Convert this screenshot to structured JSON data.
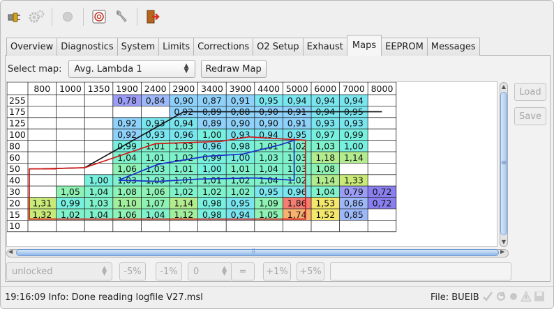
{
  "toolbar": {
    "items": [
      {
        "name": "connect-icon"
      },
      {
        "name": "settings-gears-icon"
      },
      {
        "name": "record-icon"
      },
      {
        "name": "target-icon"
      },
      {
        "name": "wrench-tools-icon"
      },
      {
        "name": "exit-door-icon"
      }
    ]
  },
  "tabs": [
    {
      "label": "Overview",
      "active": false
    },
    {
      "label": "Diagnostics",
      "active": false
    },
    {
      "label": "System",
      "active": false
    },
    {
      "label": "Limits",
      "active": false
    },
    {
      "label": "Corrections",
      "active": false
    },
    {
      "label": "O2 Setup",
      "active": false
    },
    {
      "label": "Exhaust",
      "active": false
    },
    {
      "label": "Maps",
      "active": true
    },
    {
      "label": "EEPROM",
      "active": false
    },
    {
      "label": "Messages",
      "active": false
    }
  ],
  "select_map": {
    "label": "Select map:",
    "value": "Avg. Lambda 1",
    "redraw_label": "Redraw Map"
  },
  "map_table": {
    "columns": [
      "800",
      "1000",
      "1350",
      "1900",
      "2400",
      "2900",
      "3400",
      "3900",
      "4400",
      "5000",
      "6000",
      "7000",
      "8000"
    ],
    "rows": [
      {
        "label": "255",
        "values": [
          "",
          "",
          "",
          "0,78",
          "0,84",
          "0,90",
          "0,87",
          "0,91",
          "0,95",
          "0,94",
          "0,94",
          "0,94",
          ""
        ]
      },
      {
        "label": "175",
        "values": [
          "",
          "",
          "",
          "",
          "",
          "0,92",
          "0,89",
          "0,88",
          "0,90",
          "0,91",
          "0,94",
          "0,95",
          ""
        ]
      },
      {
        "label": "125",
        "values": [
          "",
          "",
          "",
          "0,92",
          "0,93",
          "0,94",
          "0,89",
          "0,90",
          "0,90",
          "0,91",
          "0,93",
          "0,93",
          ""
        ]
      },
      {
        "label": "100",
        "values": [
          "",
          "",
          "",
          "0,92",
          "0,93",
          "0,96",
          "1,00",
          "0,93",
          "0,94",
          "0,95",
          "0,97",
          "0,99",
          ""
        ]
      },
      {
        "label": "80",
        "values": [
          "",
          "",
          "",
          "0,99",
          "1,01",
          "1,03",
          "0,96",
          "0,98",
          "1,01",
          "1,02",
          "1,03",
          "1,00",
          ""
        ]
      },
      {
        "label": "60",
        "values": [
          "",
          "",
          "",
          "1,04",
          "1,01",
          "1,02",
          "0,99",
          "1,00",
          "1,03",
          "1,03",
          "1,18",
          "1,14",
          ""
        ]
      },
      {
        "label": "50",
        "values": [
          "",
          "",
          "",
          "1,06",
          "1,03",
          "1,01",
          "1,00",
          "1,01",
          "1,04",
          "1,03",
          "1,08",
          "",
          ""
        ]
      },
      {
        "label": "40",
        "values": [
          "",
          "",
          "1,00",
          "1,03",
          "1,03",
          "1,01",
          "1,01",
          "1,02",
          "1,04",
          "1,02",
          "1,14",
          "1,33",
          ""
        ]
      },
      {
        "label": "30",
        "values": [
          "",
          "1,05",
          "1,04",
          "1,08",
          "1,06",
          "1,02",
          "1,02",
          "1,02",
          "0,95",
          "0,96",
          "1,04",
          "0,79",
          "0,72"
        ]
      },
      {
        "label": "20",
        "values": [
          "1,31",
          "0,99",
          "1,03",
          "1,10",
          "1,07",
          "1,14",
          "0,98",
          "0,95",
          "1,09",
          "1,86",
          "1,53",
          "0,86",
          "0,72"
        ]
      },
      {
        "label": "15",
        "values": [
          "1,32",
          "1,02",
          "1,04",
          "1,06",
          "1,04",
          "1,12",
          "0,98",
          "0,94",
          "1,05",
          "1,74",
          "1,52",
          "0,85",
          ""
        ]
      },
      {
        "label": "10",
        "values": [
          "",
          "",
          "",
          "",
          "",
          "",
          "",
          "",
          "",
          "",
          "",
          "",
          ""
        ]
      }
    ]
  },
  "side_buttons": {
    "load": "Load",
    "save": "Save"
  },
  "controls": {
    "lock_value": "unlocked",
    "minus5": "-5%",
    "minus1": "-1%",
    "spin_value": "0",
    "equals": "=",
    "plus1": "+1%",
    "plus5": "+5%"
  },
  "status": {
    "message": "19:16:09 Info: Done reading logfile V27.msl",
    "file": "File: BUEIB"
  }
}
